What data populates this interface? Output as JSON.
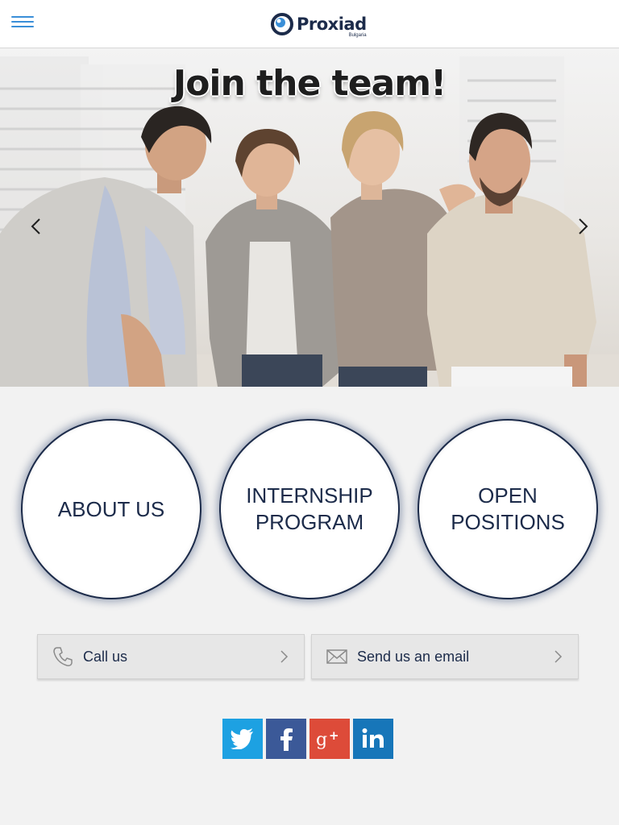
{
  "header": {
    "menu_icon": "hamburger-menu-icon",
    "logo": {
      "name": "Proxiad",
      "sub": "Bulgaria",
      "accent": "#3a8fd8"
    }
  },
  "hero": {
    "title": "Join the team!",
    "prev_icon": "chevron-left-icon",
    "next_icon": "chevron-right-icon"
  },
  "sections": [
    {
      "label": "ABOUT US"
    },
    {
      "label": "INTERNSHIP\nPROGRAM"
    },
    {
      "label": "OPEN\nPOSITIONS"
    }
  ],
  "contact": {
    "call": {
      "label": "Call us",
      "icon": "phone-icon"
    },
    "email": {
      "label": "Send us an email",
      "icon": "envelope-icon"
    }
  },
  "social": [
    {
      "name": "twitter",
      "icon": "twitter-icon",
      "color": "#1da1e2"
    },
    {
      "name": "facebook",
      "icon": "facebook-icon",
      "color": "#3b5998"
    },
    {
      "name": "google-plus",
      "icon": "google-plus-icon",
      "color": "#dd4b39"
    },
    {
      "name": "linkedin",
      "icon": "linkedin-icon",
      "color": "#1776b9"
    }
  ],
  "colors": {
    "primary_text": "#1c2b4a",
    "background": "#f2f2f2"
  }
}
